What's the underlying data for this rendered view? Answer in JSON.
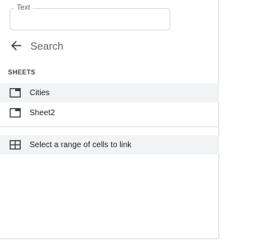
{
  "text_field": {
    "label": "Text",
    "value": ""
  },
  "search": {
    "label": "Search"
  },
  "sheets_section": {
    "header": "SHEETS",
    "items": [
      {
        "label": "Cities",
        "icon": "sheet-tab-icon",
        "selected": true
      },
      {
        "label": "Sheet2",
        "icon": "sheet-tab-icon",
        "selected": false
      }
    ]
  },
  "range_option": {
    "label": "Select a range of cells to link",
    "icon": "grid-icon"
  },
  "colors": {
    "highlight": "#f1f3f4",
    "icon": "#3c4043",
    "border": "#dadce0"
  }
}
